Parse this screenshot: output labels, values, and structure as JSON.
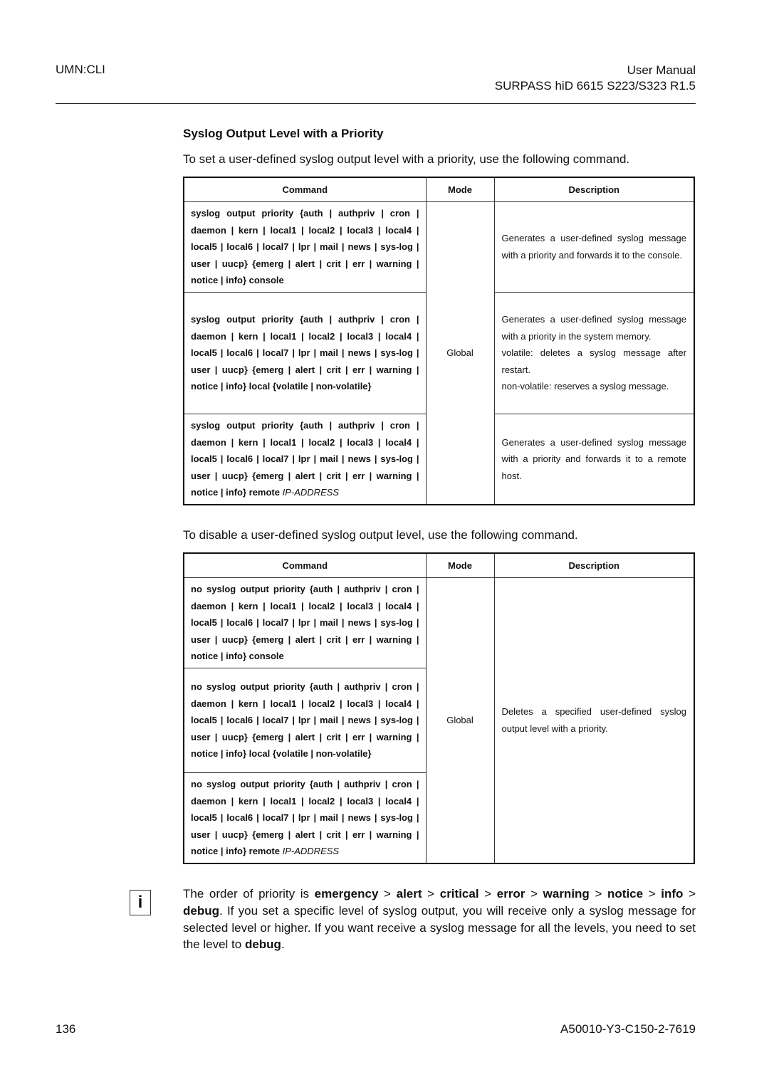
{
  "header": {
    "left": "UMN:CLI",
    "right_line1": "User Manual",
    "right_line2": "SURPASS hiD 6615 S223/S323 R1.5"
  },
  "section": {
    "title": "Syslog Output Level with a Priority",
    "intro_set": "To set a user-defined syslog output level with a priority, use the following command.",
    "intro_disable": "To disable a user-defined syslog output level, use the following command."
  },
  "table_set": {
    "columns": [
      "Command",
      "Mode",
      "Description"
    ],
    "mode": "Global",
    "rows": [
      {
        "command": "syslog output priority {auth | authpriv | cron | daemon | kern | local1 | local2 | local3 | local4 | local5 | local6 | local7 | lpr | mail | news | sys-log | user | uucp} {emerg | alert | crit | err | warning | notice | info} console",
        "command_suffix_italic": "",
        "description": "Generates a user-defined syslog message with a priority and forwards it to the console."
      },
      {
        "command": "syslog output priority {auth | authpriv | cron | daemon | kern | local1 | local2 | local3 | local4 | local5 | local6 | local7 | lpr | mail | news | sys-log | user | uucp} {emerg | alert | crit | err | warning | notice | info} local {volatile | non-volatile}",
        "command_suffix_italic": "",
        "description": "Generates a user-defined syslog message with a priority in the system memory.",
        "description_line2": "volatile: deletes a syslog message after restart.",
        "description_line3": "non-volatile: reserves a syslog message."
      },
      {
        "command": "syslog output priority {auth | authpriv | cron | daemon | kern | local1 | local2 | local3 | local4 | local5 | local6 | local7 | lpr | mail | news | sys-log | user | uucp} {emerg | alert | crit | err | warning | notice | info} remote",
        "command_suffix_italic": "IP-ADDRESS",
        "description": "Generates a user-defined syslog message with a priority and forwards it to a remote host."
      }
    ]
  },
  "table_disable": {
    "columns": [
      "Command",
      "Mode",
      "Description"
    ],
    "mode": "Global",
    "description": "Deletes a specified user-defined syslog output level with a priority.",
    "rows": [
      {
        "command": "no syslog output priority {auth | authpriv | cron | daemon | kern | local1 | local2 | local3 | local4 | local5 | local6 | local7 | lpr | mail | news | sys-log | user | uucp} {emerg | alert | crit | err | warning | notice | info} console",
        "command_suffix_italic": ""
      },
      {
        "command": "no syslog output priority {auth | authpriv | cron | daemon | kern | local1 | local2 | local3 | local4 | local5 | local6 | local7 | lpr | mail | news | sys-log | user | uucp} {emerg | alert | crit | err | warning | notice | info} local {volatile | non-volatile}",
        "command_suffix_italic": ""
      },
      {
        "command": "no syslog output priority {auth | authpriv | cron | daemon | kern | local1 | local2 | local3 | local4 | local5 | local6 | local7 | lpr | mail | news | sys-log | user | uucp} {emerg | alert | crit | err | warning | notice | info} remote",
        "command_suffix_italic": "IP-ADDRESS"
      }
    ]
  },
  "note": {
    "icon": "info-icon",
    "icon_glyph": "i",
    "t1": "The order of priority is ",
    "b1": "emergency",
    "t2": " > ",
    "b2": "alert",
    "t3": " > ",
    "b3": "critical",
    "t4": " > ",
    "b4": "error",
    "t5": " > ",
    "b5": "warning",
    "t6": " > ",
    "b6": "notice",
    "t7": " > ",
    "b7": "info",
    "t8": " > ",
    "b8": "debug",
    "t9": ". If you set a specific level of syslog output, you will receive only a syslog message for selected level or higher. If you want receive a syslog message for all the levels, you need to set the level to ",
    "b9": "debug",
    "t10": "."
  },
  "footer": {
    "page_number": "136",
    "doc_id": "A50010-Y3-C150-2-7619"
  }
}
